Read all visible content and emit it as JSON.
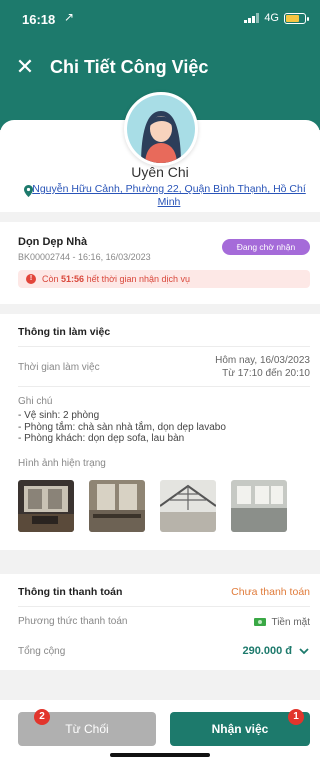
{
  "status_bar": {
    "time": "16:18",
    "location_arrow": "↗",
    "network": "4G"
  },
  "header": {
    "title": "Chi Tiết Công Việc",
    "close_icon": "close-icon"
  },
  "profile": {
    "name": "Uyên Chi",
    "address": "Nguyễn Hữu Cảnh, Phường 22, Quận Bình Thạnh, Hồ Chí Minh"
  },
  "job": {
    "title": "Dọn Dẹp Nhà",
    "code": "BK00002744 - 16:16, 16/03/2023",
    "status": "Đang chờ nhận",
    "countdown_prefix": "Còn",
    "countdown_time": "51:56",
    "countdown_suffix": "hết thời gian nhận dịch vụ"
  },
  "work_info": {
    "title": "Thông tin làm việc",
    "time_label": "Thời gian làm việc",
    "time_value_line1": "Hôm nay, 16/03/2023",
    "time_value_line2": "Từ 17:10 đến 20:10",
    "note_label": "Ghi chú",
    "note_lines": [
      "- Vệ sinh: 2 phòng",
      "- Phòng tắm: chà sàn nhà tắm, dọn dẹp lavabo",
      "- Phòng khách: dọn dẹp sofa, lau bàn"
    ],
    "photos_label": "Hình ảnh hiện trạng"
  },
  "payment": {
    "title": "Thông tin thanh toán",
    "status": "Chưa thanh toán",
    "method_label": "Phương thức thanh toán",
    "method_value": "Tiền mặt",
    "total_label": "Tổng cộng",
    "total_value": "290.000 đ"
  },
  "actions": {
    "reject_label": "Từ Chối",
    "reject_badge": "2",
    "accept_label": "Nhận việc",
    "accept_badge": "1"
  },
  "colors": {
    "primary": "#1d7a6c",
    "badge_purple": "#a56bd9",
    "danger": "#e2453a",
    "pending_orange": "#e07b3a"
  }
}
